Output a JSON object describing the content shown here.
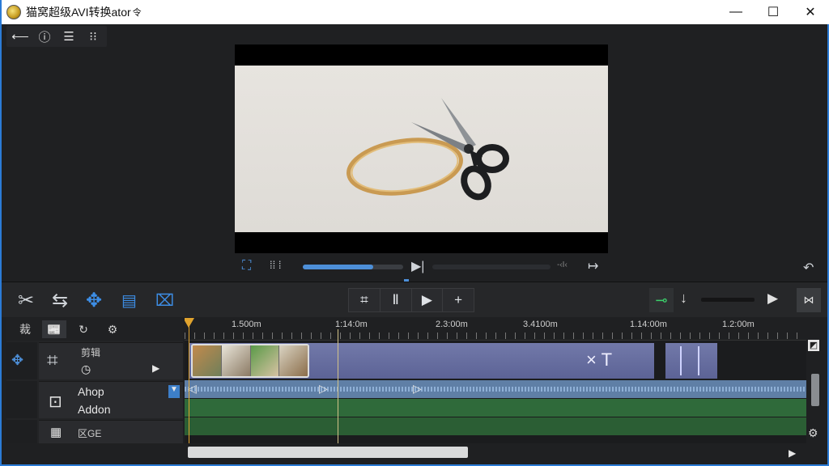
{
  "window": {
    "title": "猫窝超级AVI转换ator",
    "title_suffix": "令",
    "buttons": {
      "minimize": "—",
      "maximize": "☐",
      "close": "✕"
    }
  },
  "topbar": {
    "icons": [
      "back-arrow-icon",
      "info-icon",
      "list-icon",
      "grid-icon"
    ]
  },
  "preview": {
    "progress": 0.7
  },
  "transport": {
    "fit_icon": "fit-to-screen-icon",
    "step_icon": "pause-icon",
    "play_next_icon": "play-next-icon",
    "volume_label": "-‹I‹",
    "undo_icon": "undo-icon"
  },
  "edit_toolbar": {
    "tools": [
      "scissors-icon",
      "swap-icon",
      "move-icon",
      "subtitle-icon",
      "snapshot-icon"
    ],
    "center": [
      "crop-icon",
      "text-split-icon",
      "play-icon",
      "add-icon"
    ],
    "right": [
      "green-marker-icon",
      "download-icon",
      "play-icon",
      "close-track-icon"
    ]
  },
  "timeline": {
    "tabs": [
      "裁",
      "📰",
      "↻",
      "⚙"
    ],
    "ruler": [
      "1.500m",
      "1:14:0m",
      "2.3:00m",
      "3.4100m",
      "1.14:00m",
      "1.2:00m"
    ],
    "video_track": {
      "name": "剪辑",
      "icon_text": "×  T"
    },
    "audio_track": {
      "line1": "Ahop",
      "line2": "Addon"
    },
    "extra_track": {
      "label": "区GE"
    }
  },
  "colors": {
    "accent": "#3d8ee6",
    "video_track": "#6a71a2",
    "audio_blue": "#5f7fa6",
    "audio_green": "#2f6a3a",
    "playhead": "#e0a32e"
  }
}
